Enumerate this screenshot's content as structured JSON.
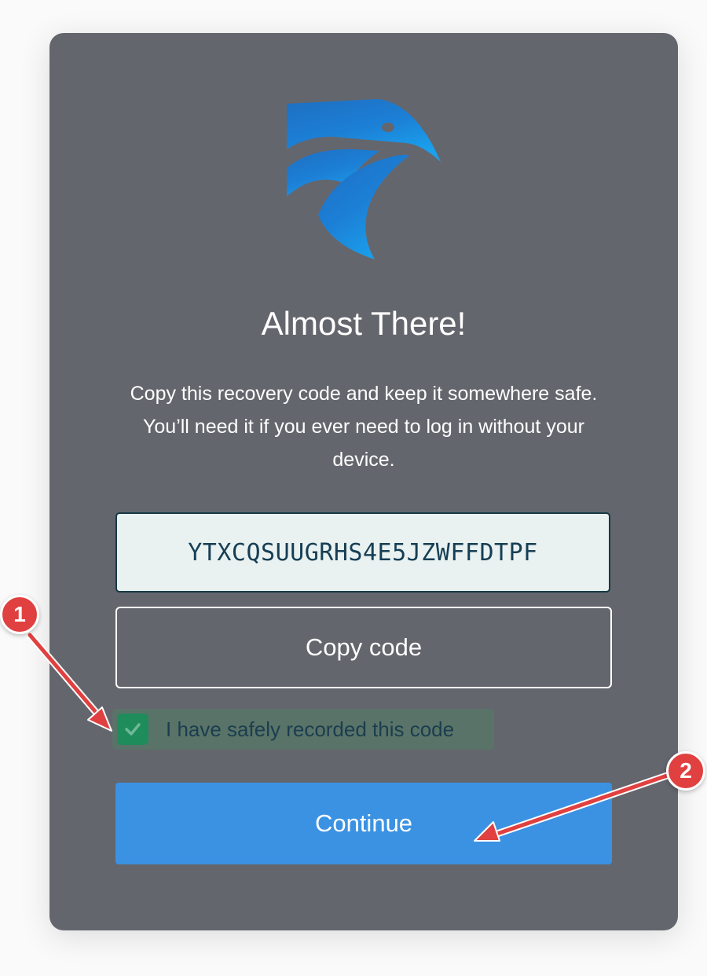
{
  "dialog": {
    "title": "Almost There!",
    "description": "Copy this recovery code and keep it somewhere safe. You’ll need it if you ever need to log in without your device.",
    "recovery_code": "YTXCQSUUGRHS4E5JZWFFDTPF",
    "copy_button_label": "Copy code",
    "confirm_checkbox": {
      "label": "I have safely recorded this code",
      "checked": true
    },
    "continue_button_label": "Continue",
    "logo_icon": "eagle-logo-icon"
  },
  "annotations": {
    "markers": [
      {
        "label": "1"
      },
      {
        "label": "2"
      }
    ]
  },
  "colors": {
    "card_background": "#64666d",
    "primary_button": "#3b92e2",
    "checkbox_checked": "#1f8c5b",
    "code_box_background": "#e9f2f0",
    "annotation_red": "#e0403f"
  }
}
